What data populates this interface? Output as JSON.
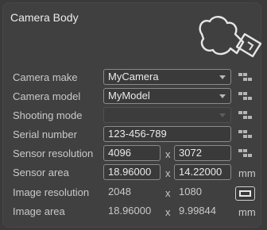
{
  "panel": {
    "title": "Camera Body"
  },
  "rows": {
    "camera_make": {
      "label": "Camera make",
      "value": "MyCamera"
    },
    "camera_model": {
      "label": "Camera model",
      "value": "MyModel"
    },
    "shooting_mode": {
      "label": "Shooting mode",
      "value": ""
    },
    "serial_number": {
      "label": "Serial number",
      "value": "123-456-789"
    },
    "sensor_resolution": {
      "label": "Sensor resolution",
      "width": "4096",
      "height": "3072"
    },
    "sensor_area": {
      "label": "Sensor area",
      "width": "18.96000",
      "height": "14.22000",
      "unit": "mm"
    },
    "image_resolution": {
      "label": "Image resolution",
      "width": "2048",
      "height": "1080"
    },
    "image_area": {
      "label": "Image area",
      "width": "18.96000",
      "height": "9.99844",
      "unit": "mm"
    }
  },
  "separator": "x",
  "icons": {
    "camera": "camera-body-icon",
    "grid": "menu-grid-icon",
    "aspect": "aspect-ratio-icon"
  }
}
